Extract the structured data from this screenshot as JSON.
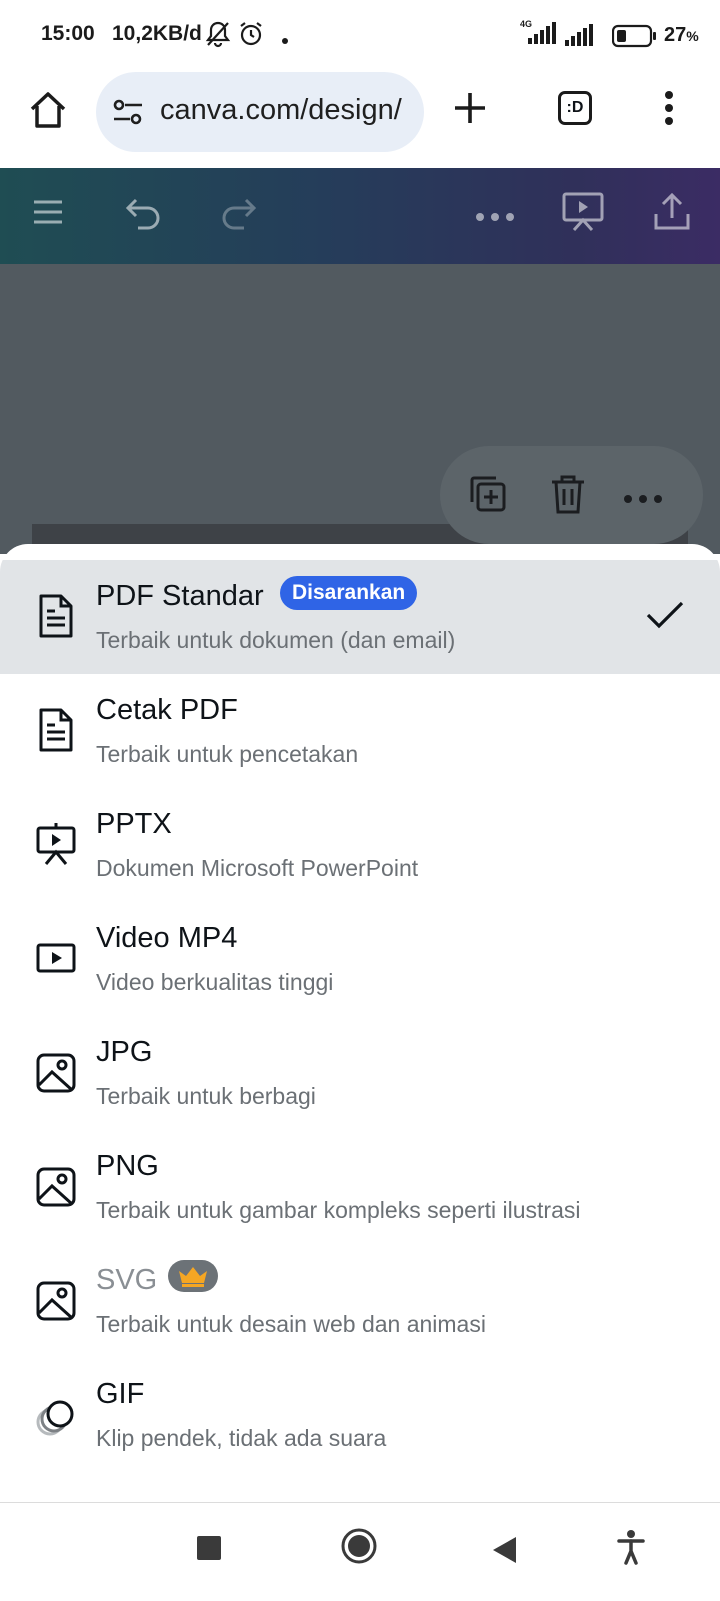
{
  "status_bar": {
    "time": "15:00",
    "net_speed": "10,2KB/d",
    "network_type": "4G",
    "battery": "27",
    "battery_suffix": "%"
  },
  "browser": {
    "url": "canva.com/design/",
    "tab_label": ":D"
  },
  "export_options": [
    {
      "title": "PDF Standar",
      "subtitle": "Terbaik untuk dokumen (dan email)",
      "badge": "Disarankan",
      "icon": "document-icon",
      "selected": true
    },
    {
      "title": "Cetak PDF",
      "subtitle": "Terbaik untuk pencetakan",
      "icon": "document-icon"
    },
    {
      "title": "PPTX",
      "subtitle": "Dokumen Microsoft PowerPoint",
      "icon": "presentation-icon"
    },
    {
      "title": "Video MP4",
      "subtitle": "Video berkualitas tinggi",
      "icon": "video-icon"
    },
    {
      "title": "JPG",
      "subtitle": "Terbaik untuk berbagi",
      "icon": "image-icon"
    },
    {
      "title": "PNG",
      "subtitle": "Terbaik untuk gambar kompleks seperti ilustrasi",
      "icon": "image-icon"
    },
    {
      "title": "SVG",
      "subtitle": "Terbaik untuk desain web dan animasi",
      "icon": "image-icon",
      "pro": true
    },
    {
      "title": "GIF",
      "subtitle": "Klip pendek, tidak ada suara",
      "icon": "gif-icon"
    }
  ],
  "colors": {
    "badge_bg": "#2f64e6",
    "selected_row_bg": "#e1e4e7",
    "crown": "#f5a623"
  }
}
